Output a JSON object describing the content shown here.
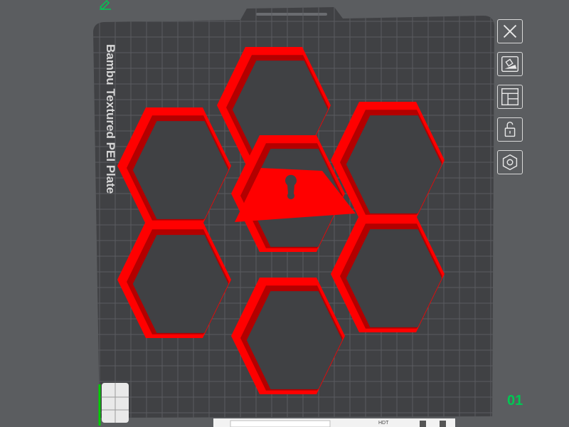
{
  "bed": {
    "label": "Bambu Textured PEI Plate",
    "plate_number": "01",
    "model_color": "#ff0000",
    "model_shade": "#b30000",
    "bed_color": "#404144",
    "grid_color": "#5a5c60"
  },
  "sidebar": {
    "buttons": [
      {
        "name": "close",
        "icon": "close-icon"
      },
      {
        "name": "auto-orient",
        "icon": "auto-orient-icon"
      },
      {
        "name": "arrange",
        "icon": "arrange-icon"
      },
      {
        "name": "lock",
        "icon": "unlock-icon"
      },
      {
        "name": "settings",
        "icon": "gear-icon"
      }
    ]
  },
  "bottom_toolbar": {
    "mode_label": "HDT"
  }
}
